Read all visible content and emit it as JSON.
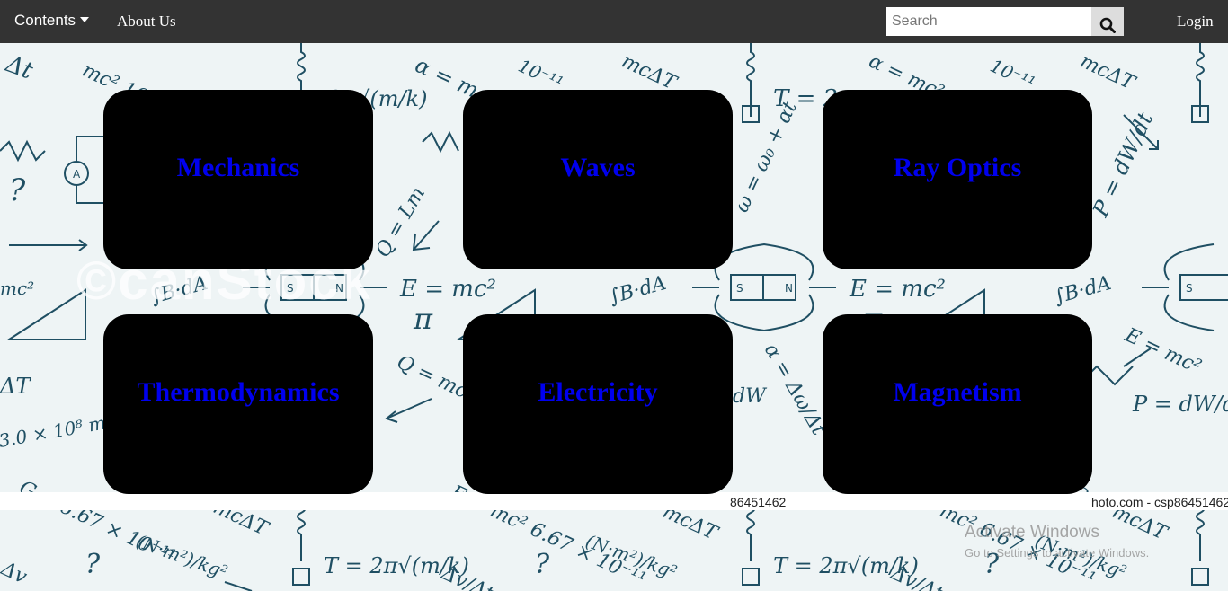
{
  "navbar": {
    "contents_label": "Contents",
    "about_label": "About Us",
    "search_placeholder": "Search",
    "search_icon": "search-icon",
    "login_label": "Login",
    "background_color": "#333333"
  },
  "topics": [
    {
      "label": "Mechanics"
    },
    {
      "label": "Waves"
    },
    {
      "label": "Ray Optics"
    },
    {
      "label": "Thermodynamics"
    },
    {
      "label": "Electricity"
    },
    {
      "label": "Magnetism"
    }
  ],
  "background": {
    "watermark_logo": "©canStock",
    "watermark_ids": [
      "86451462",
      "hoto.com - csp86451462"
    ]
  },
  "windows_notice": {
    "title": "Activate Windows",
    "subtitle": "Go to Settings to activate Windows."
  },
  "colors": {
    "card": "#000000",
    "card_text": "#0000ee",
    "formula_ink": "#1f4f63"
  }
}
